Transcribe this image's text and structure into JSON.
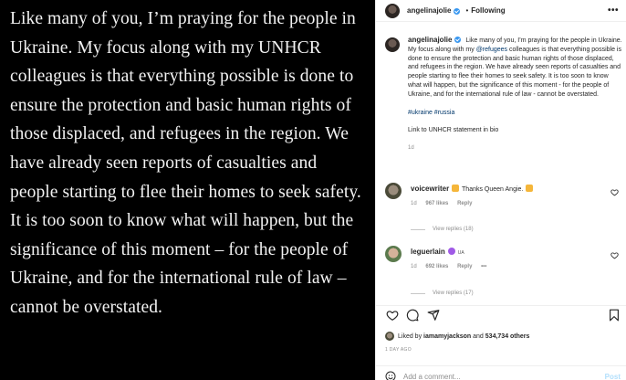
{
  "image_text": "Like many of you, I’m praying for the people in Ukraine. My focus along with my UNHCR colleagues is that everything possible is done to ensure the protection and basic human rights of those displaced, and refugees in the region. We have already seen reports of casualties and people starting to flee their homes to seek safety. It is too soon to know what will happen, but the significance of this moment – for the people of Ukraine, and for the international rule of law – cannot be overstated.",
  "header": {
    "username": "angelinajolie",
    "separator": "•",
    "follow_label": "Following",
    "more_label": "•••"
  },
  "caption": {
    "username": "angelinajolie",
    "text_before": " Like many of you, I’m praying for the people in Ukraine. My focus along with my ",
    "mention": "@refugees",
    "text_after": " colleagues is that everything possible is done to ensure the protection and basic human rights of those displaced, and refugees in the region. We have already seen reports of casualties and people starting to flee their homes to seek safety. It is too soon to know what will happen, but the significance of this moment - for the people of Ukraine, and for the international rule of law - cannot be overstated.",
    "hashtags": "#ukraine #russia",
    "link_line": "Link to UNHCR statement in bio",
    "time": "1d"
  },
  "comments": [
    {
      "username": "voicewriter",
      "text": "Thanks Queen Angie.",
      "time": "1d",
      "likes": "967 likes",
      "reply": "Reply",
      "more": "",
      "replies": "View replies (18)"
    },
    {
      "username": "leguerlain",
      "text": "UA",
      "time": "1d",
      "likes": "692 likes",
      "reply": "Reply",
      "more": "•••",
      "replies": "View replies (17)"
    }
  ],
  "likes": {
    "prefix": "Liked by ",
    "user": "iamamyjackson",
    "middle": " and ",
    "count": "534,734 others"
  },
  "posted_ago": "1 DAY AGO",
  "add_comment": {
    "placeholder": "Add a comment...",
    "post_label": "Post"
  },
  "colors": {
    "link": "#00376b",
    "verified": "#3897f0",
    "post_disabled": "#b2dffc"
  },
  "icons": [
    "heart-icon",
    "comment-icon",
    "share-icon",
    "bookmark-icon",
    "smile-icon",
    "more-icon"
  ]
}
